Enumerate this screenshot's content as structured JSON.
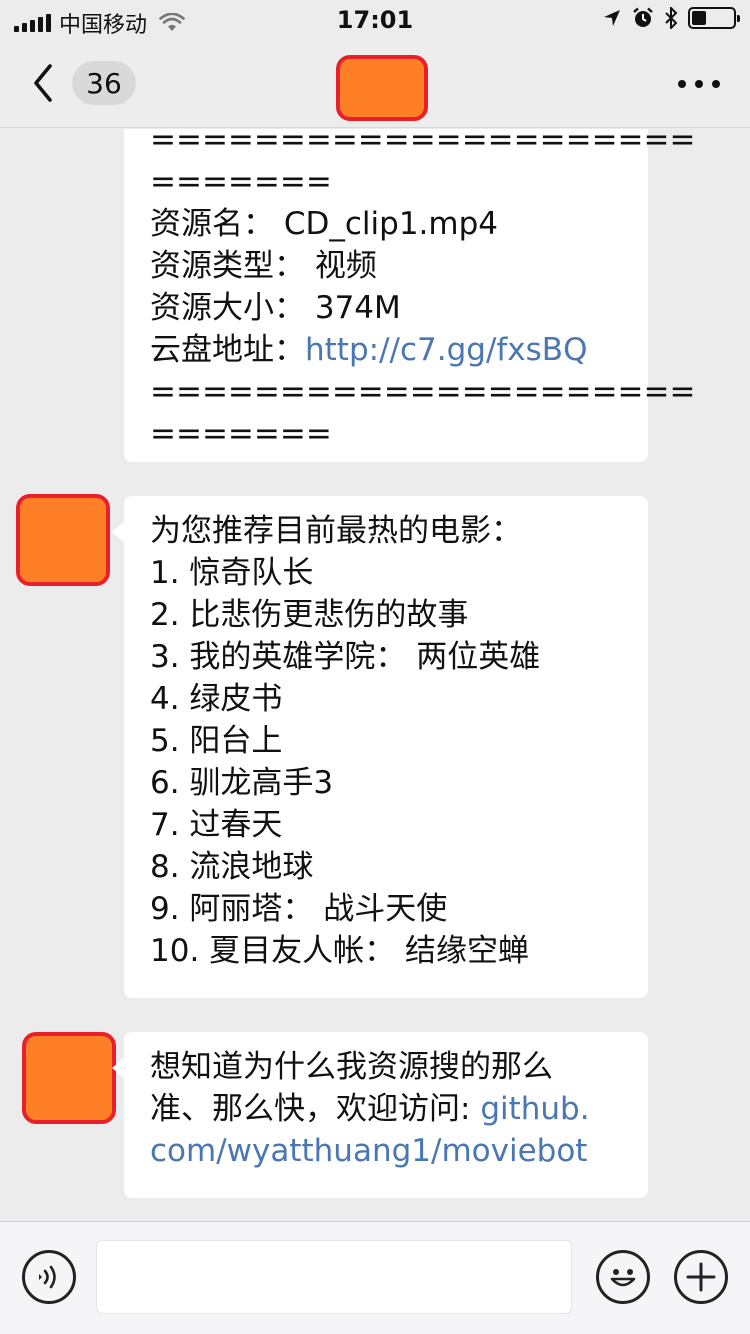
{
  "status_bar": {
    "carrier": "中国移动",
    "time": "17:01",
    "battery_level": 0.35,
    "icons": [
      "signal-icon",
      "wifi-icon",
      "location-icon",
      "alarm-icon",
      "bluetooth-icon",
      "battery-icon"
    ]
  },
  "navbar": {
    "unread_count": "36",
    "icons": [
      "back-chevron-icon",
      "more-icon"
    ]
  },
  "messages": {
    "m1": {
      "lines": [
        "=====================",
        "=======",
        "资源名： CD_clip1.mp4",
        "资源类型： 视频",
        "资源大小： 374M",
        "=====================",
        "======="
      ],
      "link_label": "云盘地址：",
      "link_url": "http://c7.gg/fxsBQ"
    },
    "m2": {
      "lines": [
        "为您推荐目前最热的电影：",
        "1. 惊奇队长",
        "2. 比悲伤更悲伤的故事",
        "3. 我的英雄学院： 两位英雄",
        "4. 绿皮书",
        "5. 阳台上",
        "6. 驯龙高手3",
        "7. 过春天",
        "8. 流浪地球",
        "9. 阿丽塔： 战斗天使",
        "10. 夏目友人帐： 结缘空蝉"
      ]
    },
    "m3": {
      "line1": "想知道为什么我资源搜的那么",
      "line2_text": "准、那么快，欢迎访问: ",
      "line2_link": "github.",
      "line3_link": "com/wyatthuang1/moviebot"
    }
  },
  "input_bar": {
    "icons": [
      "voice-icon",
      "emoji-icon",
      "plus-icon"
    ]
  },
  "colors": {
    "avatar_fill": "#ff7f27",
    "avatar_border": "#e8202a",
    "link": "#4a77b3",
    "background": "#ececec"
  }
}
